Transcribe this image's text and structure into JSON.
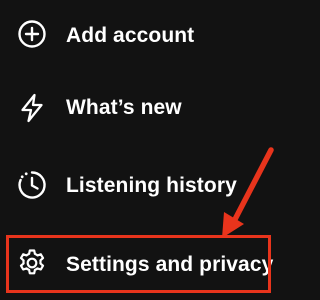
{
  "menu": {
    "items": [
      {
        "label": "Add account",
        "icon": "plus-circle-icon"
      },
      {
        "label": "What’s new",
        "icon": "lightning-bolt-icon"
      },
      {
        "label": "Listening history",
        "icon": "history-clock-icon"
      },
      {
        "label": "Settings and privacy",
        "icon": "gear-icon"
      }
    ]
  },
  "annotation": {
    "color": "#e8341c",
    "shape": "arrow pointing to highlighted Settings and privacy item"
  },
  "colors": {
    "background": "#121212",
    "text": "#ffffff",
    "highlight": "#e8341c"
  }
}
